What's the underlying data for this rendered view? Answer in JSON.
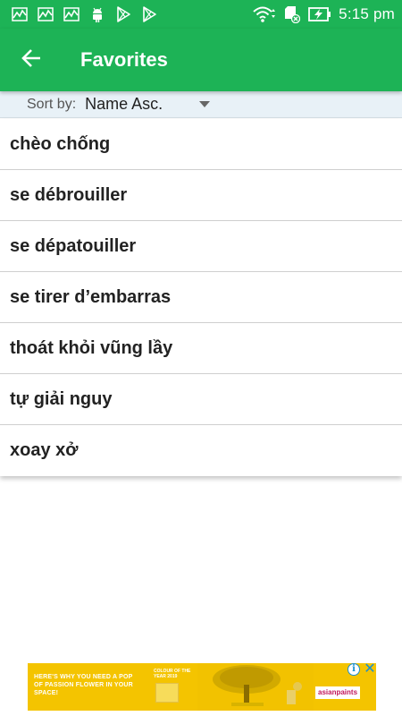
{
  "status_bar": {
    "time": "5:15 pm",
    "left_icons": [
      "chart-icon",
      "chart-icon",
      "chart-icon",
      "android-icon",
      "play-store-icon",
      "play-store-icon"
    ],
    "right_icons": [
      "wifi-icon",
      "sd-card-icon",
      "battery-charging-icon"
    ]
  },
  "app_bar": {
    "title": "Favorites",
    "back_icon": "arrow-left-icon",
    "color": "#1db356"
  },
  "sort": {
    "label": "Sort by:",
    "value": "Name Asc."
  },
  "favorites": [
    "chèo chống",
    "se débrouiller",
    "se dépatouiller",
    "se tirer d’embarras",
    "thoát khỏi vũng lầy",
    "tự giải nguy",
    "xoay xở"
  ],
  "ad": {
    "headline": "HERE'S WHY YOU NEED A POP OF PASSION FLOWER IN YOUR SPACE!",
    "sub": "COLOUR OF THE YEAR 2019",
    "brand": "asianpaints",
    "info_icon": "info-icon",
    "close_icon": "close-icon"
  }
}
